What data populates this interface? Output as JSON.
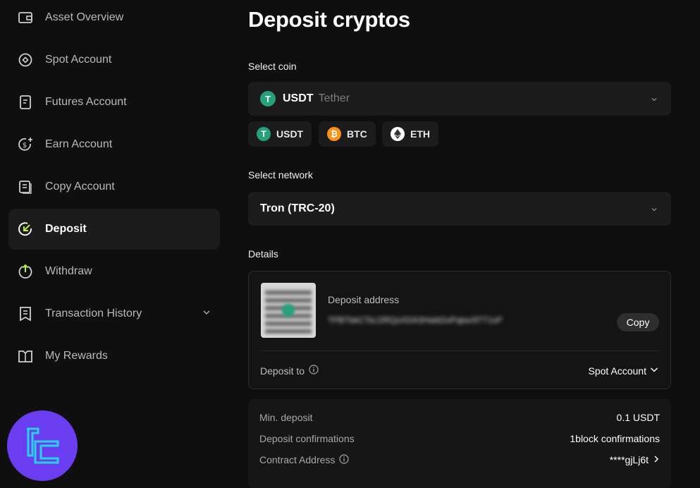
{
  "sidebar": {
    "items": [
      {
        "label": "Asset Overview",
        "icon": "wallet-icon"
      },
      {
        "label": "Spot Account",
        "icon": "target-icon"
      },
      {
        "label": "Futures Account",
        "icon": "document-icon"
      },
      {
        "label": "Earn Account",
        "icon": "coin-plus-icon"
      },
      {
        "label": "Copy Account",
        "icon": "copy-doc-icon"
      },
      {
        "label": "Deposit",
        "icon": "deposit-icon",
        "active": true
      },
      {
        "label": "Withdraw",
        "icon": "withdraw-icon"
      },
      {
        "label": "Transaction History",
        "icon": "receipt-icon",
        "has_submenu": true
      },
      {
        "label": "My Rewards",
        "icon": "rewards-icon"
      }
    ]
  },
  "main": {
    "title": "Deposit cryptos",
    "select_coin": {
      "label": "Select coin",
      "selected_symbol": "USDT",
      "selected_name": "Tether",
      "quick_picks": [
        "USDT",
        "BTC",
        "ETH"
      ]
    },
    "select_network": {
      "label": "Select network",
      "selected": "Tron (TRC-20)"
    },
    "details": {
      "label": "Details",
      "deposit_address_label": "Deposit address",
      "deposit_address_value": "TPBTbkCTsLDRQsXDA3HwbDoPqbsr9TT1xP",
      "copy_label": "Copy",
      "deposit_to_label": "Deposit to",
      "deposit_to_value": "Spot Account"
    },
    "info": {
      "min_deposit_label": "Min. deposit",
      "min_deposit_value": "0.1 USDT",
      "confirmations_label": "Deposit confirmations",
      "confirmations_value": "1block confirmations",
      "contract_label": "Contract Address",
      "contract_value": "****gjLj6t"
    }
  },
  "colors": {
    "background": "#0f0f0f",
    "panel": "#1c1c1c",
    "usdt": "#26a17b",
    "btc": "#f7931a",
    "eth": "#ffffff",
    "logo_badge": "#6a3df0",
    "logo_accent": "#27d3e8"
  }
}
